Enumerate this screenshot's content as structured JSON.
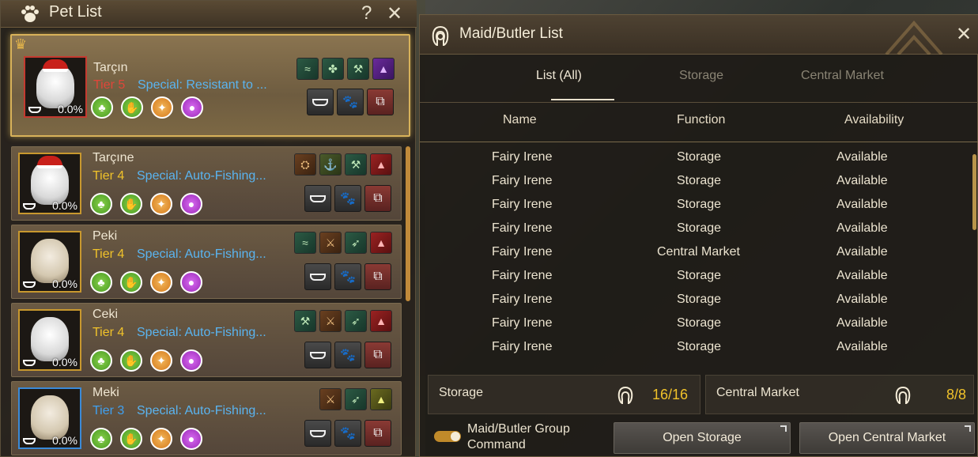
{
  "pet_panel": {
    "title": "Pet List",
    "help_glyph": "?",
    "close_glyph": "✕",
    "pets": [
      {
        "name": "Tarçın",
        "tier": "Tier 5",
        "special": "Special: Resistant to ...",
        "hunger": "0.0%"
      },
      {
        "name": "Tarçıne",
        "tier": "Tier 4",
        "special": "Special: Auto-Fishing...",
        "hunger": "0.0%"
      },
      {
        "name": "Peki",
        "tier": "Tier 4",
        "special": "Special: Auto-Fishing...",
        "hunger": "0.0%"
      },
      {
        "name": "Ceki",
        "tier": "Tier 4",
        "special": "Special: Auto-Fishing...",
        "hunger": "0.0%"
      },
      {
        "name": "Meki",
        "tier": "Tier 3",
        "special": "Special: Auto-Fishing...",
        "hunger": "0.0%"
      }
    ],
    "colors": {
      "tier_5": "#e0463a",
      "tier_4": "#f0c22a",
      "tier_3": "#3fa0f0",
      "special": "#5ab4f0"
    }
  },
  "maid_panel": {
    "title": "Maid/Butler List",
    "close_glyph": "✕",
    "tabs": [
      {
        "label": "List (All)",
        "active": true
      },
      {
        "label": "Storage",
        "active": false
      },
      {
        "label": "Central Market",
        "active": false
      }
    ],
    "columns": [
      "Name",
      "Function",
      "Availability"
    ],
    "rows": [
      {
        "name": "Fairy Irene",
        "function": "Storage",
        "availability": "Available"
      },
      {
        "name": "Fairy Irene",
        "function": "Storage",
        "availability": "Available"
      },
      {
        "name": "Fairy Irene",
        "function": "Storage",
        "availability": "Available"
      },
      {
        "name": "Fairy Irene",
        "function": "Storage",
        "availability": "Available"
      },
      {
        "name": "Fairy Irene",
        "function": "Central Market",
        "availability": "Available"
      },
      {
        "name": "Fairy Irene",
        "function": "Storage",
        "availability": "Available"
      },
      {
        "name": "Fairy Irene",
        "function": "Storage",
        "availability": "Available"
      },
      {
        "name": "Fairy Irene",
        "function": "Storage",
        "availability": "Available"
      },
      {
        "name": "Fairy Irene",
        "function": "Storage",
        "availability": "Available"
      }
    ],
    "storage_count": {
      "label": "Storage",
      "value": "16/16"
    },
    "market_count": {
      "label": "Central Market",
      "value": "8/8"
    },
    "group_command_label": "Maid/Butler Group Command",
    "group_command_enabled": true,
    "open_storage_label": "Open Storage",
    "open_market_label": "Open Central Market",
    "colors": {
      "count": "#f0c22a",
      "accent": "#c08a2a"
    }
  }
}
